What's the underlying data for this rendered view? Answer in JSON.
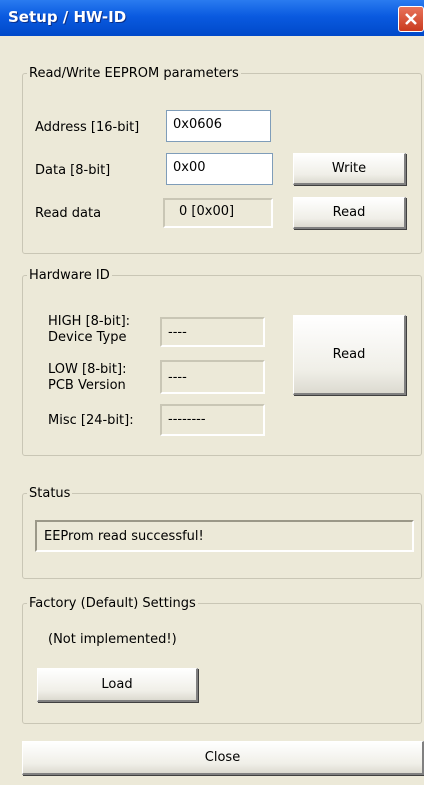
{
  "window": {
    "title": "Setup / HW-ID",
    "close_icon": "close-icon"
  },
  "eeprom": {
    "legend": "Read/Write EEPROM parameters",
    "address_label": "Address [16-bit]",
    "address_value": "0x0606",
    "data_label": "Data [8-bit]",
    "data_value": "0x00",
    "read_data_label": "Read data",
    "read_data_value": "0 [0x00]",
    "write_button": "Write",
    "read_button": "Read"
  },
  "hardware": {
    "legend": "Hardware ID",
    "high_label_1": "HIGH [8-bit]:",
    "high_label_2": "Device Type",
    "high_value": "----",
    "low_label_1": "LOW [8-bit]:",
    "low_label_2": "PCB Version",
    "low_value": "----",
    "misc_label": "Misc [24-bit]:",
    "misc_value": "--------",
    "read_button": "Read"
  },
  "status": {
    "legend": "Status",
    "message": "EEProm read successful!"
  },
  "factory": {
    "legend": "Factory (Default) Settings",
    "note": "(Not implemented!)",
    "load_button": "Load"
  },
  "footer": {
    "close_button": "Close"
  }
}
